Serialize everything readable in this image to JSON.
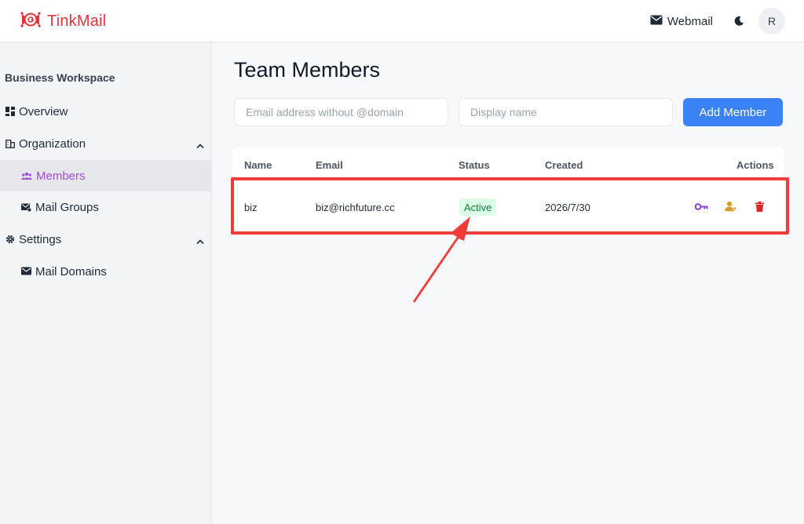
{
  "header": {
    "app_name": "TinkMail",
    "webmail_label": "Webmail",
    "avatar_initial": "R"
  },
  "sidebar": {
    "workspace_title": "Business Workspace",
    "items": [
      {
        "label": "Overview",
        "icon": "dashboard-icon"
      },
      {
        "label": "Organization",
        "icon": "building-icon",
        "expanded": true
      },
      {
        "label": "Members",
        "icon": "users-icon",
        "active": true
      },
      {
        "label": "Mail Groups",
        "icon": "mail-group-icon"
      },
      {
        "label": "Settings",
        "icon": "gear-icon",
        "expanded": true
      },
      {
        "label": "Mail Domains",
        "icon": "inbox-icon"
      }
    ]
  },
  "main": {
    "title": "Team Members",
    "email_placeholder": "Email address without @domain",
    "name_placeholder": "Display name",
    "add_button": "Add Member",
    "table": {
      "columns": [
        "Name",
        "Email",
        "Status",
        "Created",
        "Actions"
      ],
      "rows": [
        {
          "name": "biz",
          "email": "biz@richfuture.cc",
          "status": "Active",
          "created": "2026/7/30"
        }
      ]
    }
  },
  "colors": {
    "brand": "#e5333b",
    "accent": "#3b82f6",
    "active_nav": "#9b4dd6",
    "status_active_bg": "#dcfce7",
    "status_active_text": "#15803d",
    "key_icon": "#8b3fd9",
    "user_icon": "#d99a1e",
    "delete_icon": "#dc2626",
    "annotation": "#f23b3b"
  }
}
